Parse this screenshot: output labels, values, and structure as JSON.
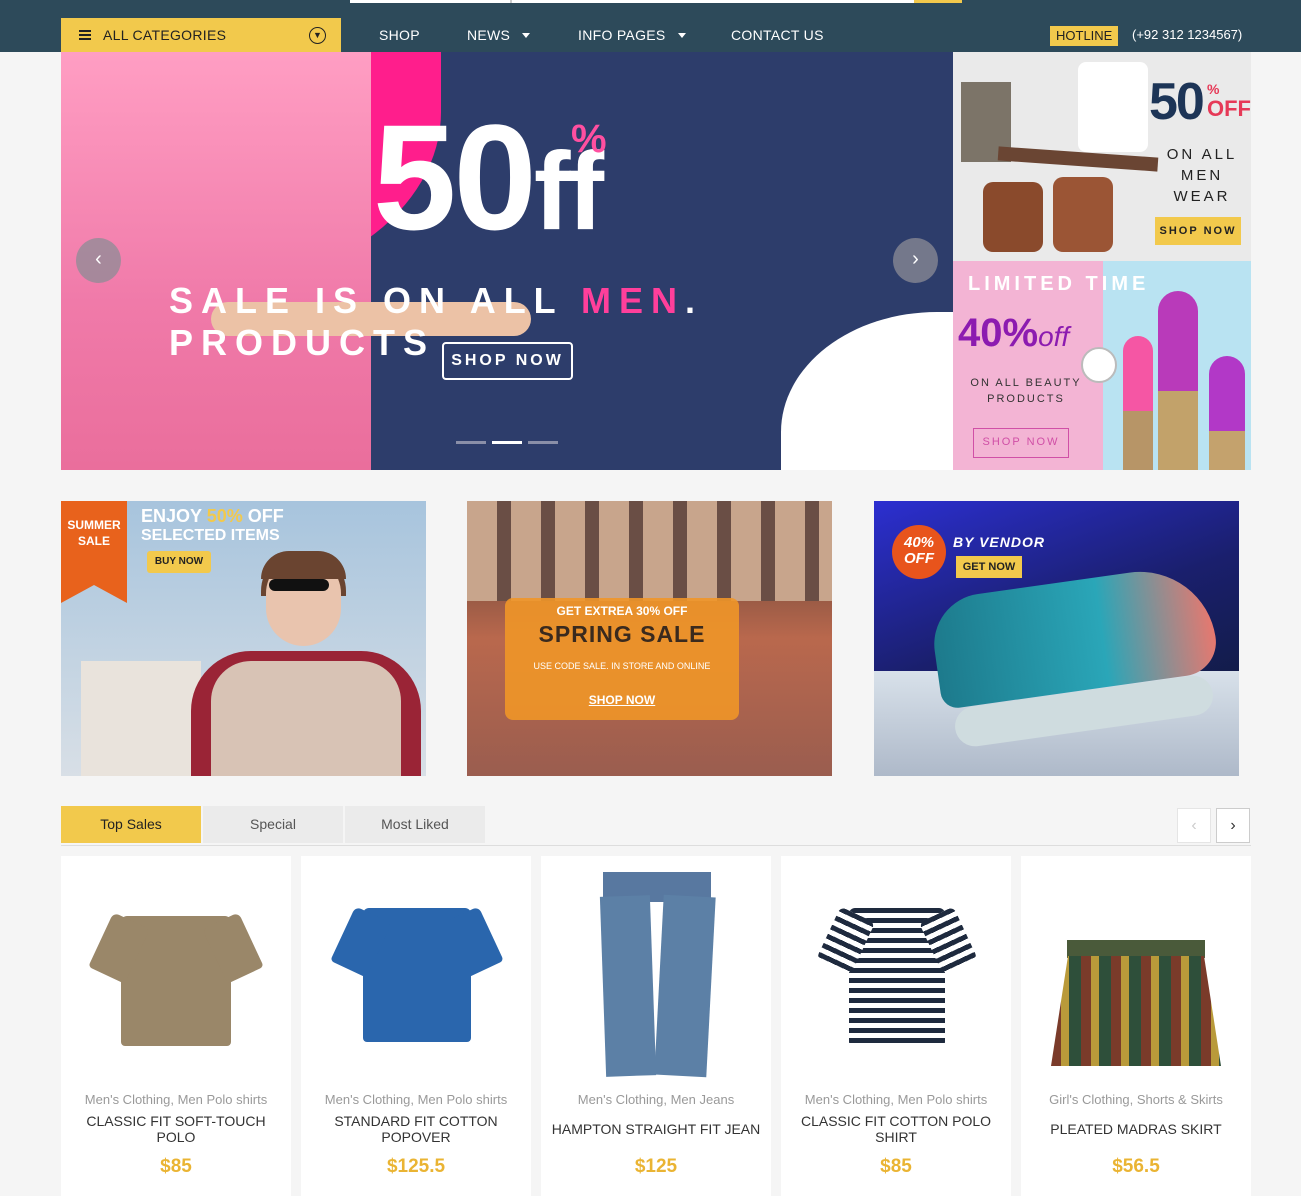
{
  "nav": {
    "categories_label": "ALL CATEGORIES",
    "menu": [
      "SHOP",
      "NEWS",
      "INFO PAGES",
      "CONTACT US"
    ],
    "hotline_label": "HOTLINE",
    "phone": "(+92 312 1234567)"
  },
  "hero": {
    "headline": "50",
    "headline_suffix": "ff",
    "percent": "%",
    "sale_pre": "SALE IS ON ALL ",
    "sale_highlight": "MEN",
    "sale_post": ". PRODUCTS",
    "button": "SHOP NOW",
    "prev_icon": "‹",
    "next_icon": "›",
    "active_slide": 2,
    "slide_count": 3
  },
  "side_banner_1": {
    "big": "50",
    "percent": "%",
    "off": "OFF",
    "line1": "ON ALL",
    "line2": "MEN WEAR",
    "button": "SHOP NOW"
  },
  "side_banner_2": {
    "title": "LIMITED TIME",
    "percent": "40%",
    "off": "off",
    "line1": "ON ALL BEAUTY",
    "line2": "PRODUCTS",
    "button": "SHOP NOW"
  },
  "promo1": {
    "flag_line1": "SUMMER",
    "flag_line2": "SALE",
    "enjoy": "ENJOY",
    "percent": "50%",
    "off": "OFF",
    "selected": "SELECTED ITEMS",
    "button": "BUY NOW"
  },
  "promo2": {
    "line1": "GET EXTREA 30% OFF",
    "title": "SPRING SALE",
    "line3": "USE CODE SALE. IN STORE AND ONLINE",
    "button": "SHOP NOW"
  },
  "promo3": {
    "badge_pct": "40%",
    "badge_off": "OFF",
    "by_vendor": "BY VENDOR",
    "button": "GET NOW"
  },
  "tabs": [
    "Top Sales",
    "Special",
    "Most Liked"
  ],
  "carousel_nav": {
    "prev": "‹",
    "next": "›"
  },
  "products": [
    {
      "category": "Men's Clothing, Men Polo shirts",
      "name": "CLASSIC FIT SOFT-TOUCH POLO",
      "price": "$85",
      "color": "#8e7b62"
    },
    {
      "category": "Men's Clothing, Men Polo shirts",
      "name": "STANDARD FIT COTTON POPOVER",
      "price": "$125.5",
      "color": "#2a6bb3"
    },
    {
      "category": "Men's Clothing, Men Jeans",
      "name": "HAMPTON STRAIGHT FIT JEAN",
      "price": "$125",
      "color": "#5b7fa3"
    },
    {
      "category": "Men's Clothing, Men Polo shirts",
      "name": "CLASSIC FIT COTTON POLO SHIRT",
      "price": "$85",
      "color": "#1e2a3e"
    },
    {
      "category": "Girl's Clothing, Shorts & Skirts",
      "name": "PLEATED MADRAS SKIRT",
      "price": "$56.5",
      "color": "#6b6a3a"
    }
  ],
  "colors": {
    "accent": "#f2c94c",
    "nav_bg": "#2d4a5a",
    "price": "#eab433"
  }
}
